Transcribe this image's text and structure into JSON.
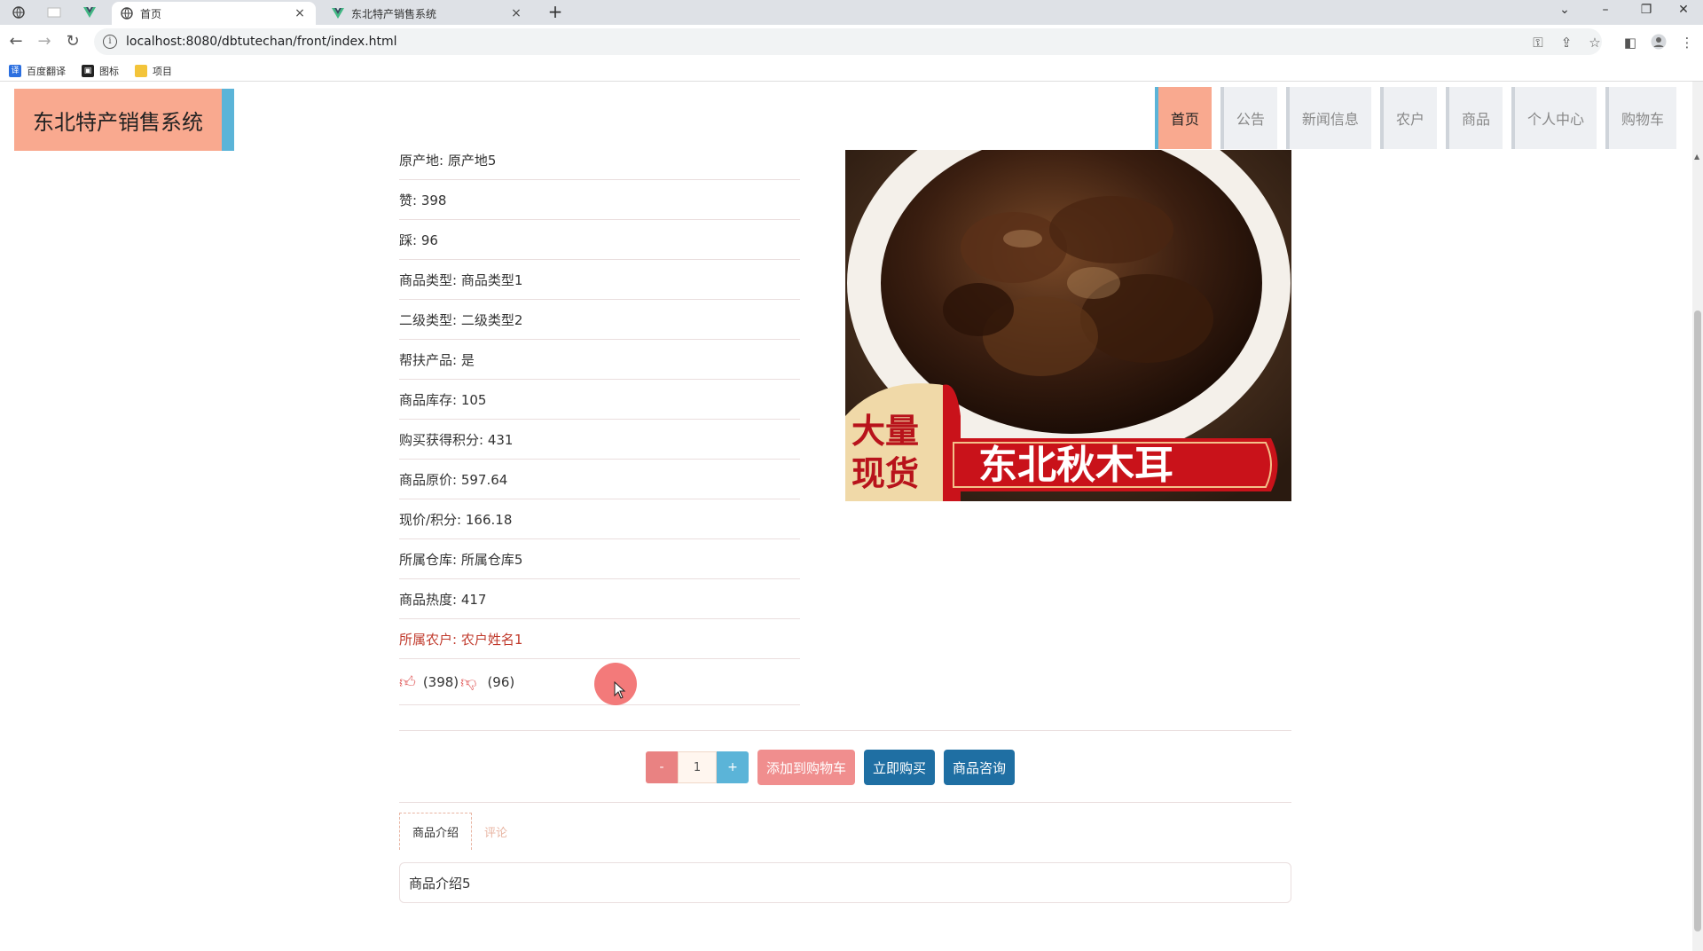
{
  "browser": {
    "tabs": [
      {
        "title": "首页",
        "active": true
      },
      {
        "title": "东北特产销售系统",
        "active": false
      }
    ],
    "url": "localhost:8080/dbtutechan/front/index.html",
    "bookmarks": [
      {
        "label": "百度翻译",
        "color": "#2b6fe0"
      },
      {
        "label": "图标",
        "color": "#222222"
      },
      {
        "label": "项目",
        "color": "#f3c43a"
      }
    ],
    "tab_close": "×",
    "new_tab": "+",
    "window_controls": [
      "⌄",
      "–",
      "❐",
      "✕"
    ]
  },
  "site": {
    "logo": "东北特产销售系统",
    "nav": [
      {
        "label": "首页",
        "active": true
      },
      {
        "label": "公告"
      },
      {
        "label": "新闻信息"
      },
      {
        "label": "农户"
      },
      {
        "label": "商品"
      },
      {
        "label": "个人中心"
      },
      {
        "label": "购物车"
      }
    ],
    "accent_salmon": "#f9a98f",
    "accent_blue": "#5bb4d8"
  },
  "details": [
    "原产地: 原产地5",
    "赞: 398",
    "踩: 96",
    "商品类型: 商品类型1",
    "二级类型: 二级类型2",
    "帮扶产品: 是",
    "商品库存: 105",
    "购买获得积分: 431",
    "商品原价: 597.64",
    "现价/积分: 166.18",
    "所属仓库: 所属仓库5",
    "商品热度: 417",
    "所属农户: 农户姓名1"
  ],
  "votes": {
    "like": "(398)",
    "dislike": "(96)"
  },
  "image": {
    "badge_line1": "大量",
    "badge_line2": "现货",
    "banner": "东北秋木耳"
  },
  "actions": {
    "minus": "-",
    "qty": "1",
    "plus": "+",
    "add_to_cart": "添加到购物车",
    "buy_now": "立即购买",
    "consult": "商品咨询"
  },
  "product_tabs": [
    {
      "label": "商品介绍",
      "active": true
    },
    {
      "label": "评论"
    }
  ],
  "intro": "商品介绍5"
}
